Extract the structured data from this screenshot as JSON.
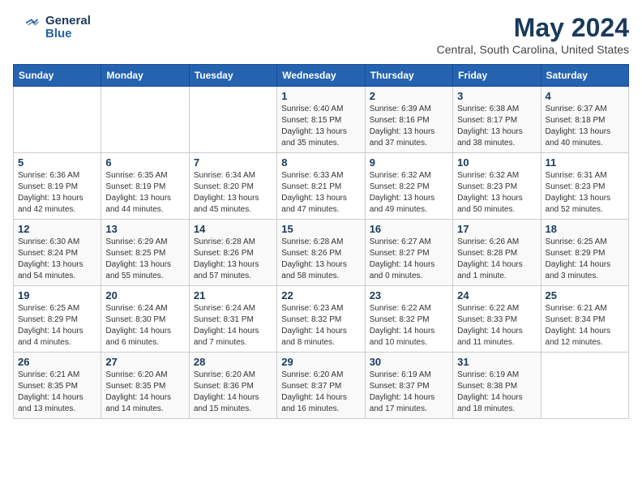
{
  "header": {
    "logo_line1": "General",
    "logo_line2": "Blue",
    "month_year": "May 2024",
    "location": "Central, South Carolina, United States"
  },
  "days_of_week": [
    "Sunday",
    "Monday",
    "Tuesday",
    "Wednesday",
    "Thursday",
    "Friday",
    "Saturday"
  ],
  "weeks": [
    [
      {
        "day": "",
        "info": ""
      },
      {
        "day": "",
        "info": ""
      },
      {
        "day": "",
        "info": ""
      },
      {
        "day": "1",
        "info": "Sunrise: 6:40 AM\nSunset: 8:15 PM\nDaylight: 13 hours\nand 35 minutes."
      },
      {
        "day": "2",
        "info": "Sunrise: 6:39 AM\nSunset: 8:16 PM\nDaylight: 13 hours\nand 37 minutes."
      },
      {
        "day": "3",
        "info": "Sunrise: 6:38 AM\nSunset: 8:17 PM\nDaylight: 13 hours\nand 38 minutes."
      },
      {
        "day": "4",
        "info": "Sunrise: 6:37 AM\nSunset: 8:18 PM\nDaylight: 13 hours\nand 40 minutes."
      }
    ],
    [
      {
        "day": "5",
        "info": "Sunrise: 6:36 AM\nSunset: 8:19 PM\nDaylight: 13 hours\nand 42 minutes."
      },
      {
        "day": "6",
        "info": "Sunrise: 6:35 AM\nSunset: 8:19 PM\nDaylight: 13 hours\nand 44 minutes."
      },
      {
        "day": "7",
        "info": "Sunrise: 6:34 AM\nSunset: 8:20 PM\nDaylight: 13 hours\nand 45 minutes."
      },
      {
        "day": "8",
        "info": "Sunrise: 6:33 AM\nSunset: 8:21 PM\nDaylight: 13 hours\nand 47 minutes."
      },
      {
        "day": "9",
        "info": "Sunrise: 6:32 AM\nSunset: 8:22 PM\nDaylight: 13 hours\nand 49 minutes."
      },
      {
        "day": "10",
        "info": "Sunrise: 6:32 AM\nSunset: 8:23 PM\nDaylight: 13 hours\nand 50 minutes."
      },
      {
        "day": "11",
        "info": "Sunrise: 6:31 AM\nSunset: 8:23 PM\nDaylight: 13 hours\nand 52 minutes."
      }
    ],
    [
      {
        "day": "12",
        "info": "Sunrise: 6:30 AM\nSunset: 8:24 PM\nDaylight: 13 hours\nand 54 minutes."
      },
      {
        "day": "13",
        "info": "Sunrise: 6:29 AM\nSunset: 8:25 PM\nDaylight: 13 hours\nand 55 minutes."
      },
      {
        "day": "14",
        "info": "Sunrise: 6:28 AM\nSunset: 8:26 PM\nDaylight: 13 hours\nand 57 minutes."
      },
      {
        "day": "15",
        "info": "Sunrise: 6:28 AM\nSunset: 8:26 PM\nDaylight: 13 hours\nand 58 minutes."
      },
      {
        "day": "16",
        "info": "Sunrise: 6:27 AM\nSunset: 8:27 PM\nDaylight: 14 hours\nand 0 minutes."
      },
      {
        "day": "17",
        "info": "Sunrise: 6:26 AM\nSunset: 8:28 PM\nDaylight: 14 hours\nand 1 minute."
      },
      {
        "day": "18",
        "info": "Sunrise: 6:25 AM\nSunset: 8:29 PM\nDaylight: 14 hours\nand 3 minutes."
      }
    ],
    [
      {
        "day": "19",
        "info": "Sunrise: 6:25 AM\nSunset: 8:29 PM\nDaylight: 14 hours\nand 4 minutes."
      },
      {
        "day": "20",
        "info": "Sunrise: 6:24 AM\nSunset: 8:30 PM\nDaylight: 14 hours\nand 6 minutes."
      },
      {
        "day": "21",
        "info": "Sunrise: 6:24 AM\nSunset: 8:31 PM\nDaylight: 14 hours\nand 7 minutes."
      },
      {
        "day": "22",
        "info": "Sunrise: 6:23 AM\nSunset: 8:32 PM\nDaylight: 14 hours\nand 8 minutes."
      },
      {
        "day": "23",
        "info": "Sunrise: 6:22 AM\nSunset: 8:32 PM\nDaylight: 14 hours\nand 10 minutes."
      },
      {
        "day": "24",
        "info": "Sunrise: 6:22 AM\nSunset: 8:33 PM\nDaylight: 14 hours\nand 11 minutes."
      },
      {
        "day": "25",
        "info": "Sunrise: 6:21 AM\nSunset: 8:34 PM\nDaylight: 14 hours\nand 12 minutes."
      }
    ],
    [
      {
        "day": "26",
        "info": "Sunrise: 6:21 AM\nSunset: 8:35 PM\nDaylight: 14 hours\nand 13 minutes."
      },
      {
        "day": "27",
        "info": "Sunrise: 6:20 AM\nSunset: 8:35 PM\nDaylight: 14 hours\nand 14 minutes."
      },
      {
        "day": "28",
        "info": "Sunrise: 6:20 AM\nSunset: 8:36 PM\nDaylight: 14 hours\nand 15 minutes."
      },
      {
        "day": "29",
        "info": "Sunrise: 6:20 AM\nSunset: 8:37 PM\nDaylight: 14 hours\nand 16 minutes."
      },
      {
        "day": "30",
        "info": "Sunrise: 6:19 AM\nSunset: 8:37 PM\nDaylight: 14 hours\nand 17 minutes."
      },
      {
        "day": "31",
        "info": "Sunrise: 6:19 AM\nSunset: 8:38 PM\nDaylight: 14 hours\nand 18 minutes."
      },
      {
        "day": "",
        "info": ""
      }
    ]
  ]
}
